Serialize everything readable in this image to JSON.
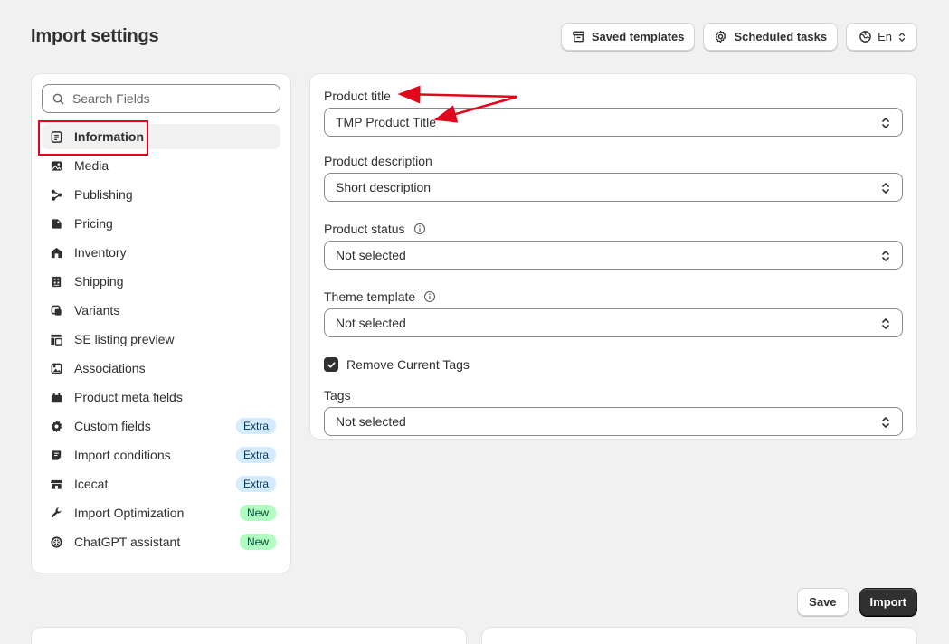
{
  "header": {
    "title": "Import settings",
    "saved_templates_label": "Saved templates",
    "scheduled_tasks_label": "Scheduled tasks",
    "language_label": "En"
  },
  "sidebar": {
    "search_placeholder": "Search Fields",
    "items": [
      {
        "label": "Information",
        "icon": "document-icon",
        "active": true
      },
      {
        "label": "Media",
        "icon": "image-icon"
      },
      {
        "label": "Publishing",
        "icon": "share-nodes-icon"
      },
      {
        "label": "Pricing",
        "icon": "price-tag-icon"
      },
      {
        "label": "Inventory",
        "icon": "warehouse-icon"
      },
      {
        "label": "Shipping",
        "icon": "barcode-icon"
      },
      {
        "label": "Variants",
        "icon": "variants-icon"
      },
      {
        "label": "SE listing preview",
        "icon": "search-listing-icon"
      },
      {
        "label": "Associations",
        "icon": "linked-images-icon"
      },
      {
        "label": "Product meta fields",
        "icon": "meta-fields-icon"
      },
      {
        "label": "Custom fields",
        "icon": "gear-icon",
        "badge": "Extra"
      },
      {
        "label": "Import conditions",
        "icon": "note-icon",
        "badge": "Extra"
      },
      {
        "label": "Icecat",
        "icon": "store-icon",
        "badge": "Extra"
      },
      {
        "label": "Import Optimization",
        "icon": "wrench-icon",
        "badge": "New"
      },
      {
        "label": "ChatGPT assistant",
        "icon": "chatgpt-icon",
        "badge": "New"
      }
    ]
  },
  "form": {
    "product_title": {
      "label": "Product title",
      "value": "TMP Product Title"
    },
    "product_description": {
      "label": "Product description",
      "value": "Short description"
    },
    "product_status": {
      "label": "Product status",
      "value": "Not selected"
    },
    "theme_template": {
      "label": "Theme template",
      "value": "Not selected"
    },
    "remove_current_tags": {
      "label": "Remove Current Tags",
      "checked": true
    },
    "tags": {
      "label": "Tags",
      "value": "Not selected"
    }
  },
  "footer": {
    "save_label": "Save",
    "import_label": "Import"
  },
  "colors": {
    "annotation_red": "#e3061a",
    "badge_extra_bg": "#d5ebff",
    "badge_new_bg": "#affebf",
    "primary_button": "#303030"
  }
}
